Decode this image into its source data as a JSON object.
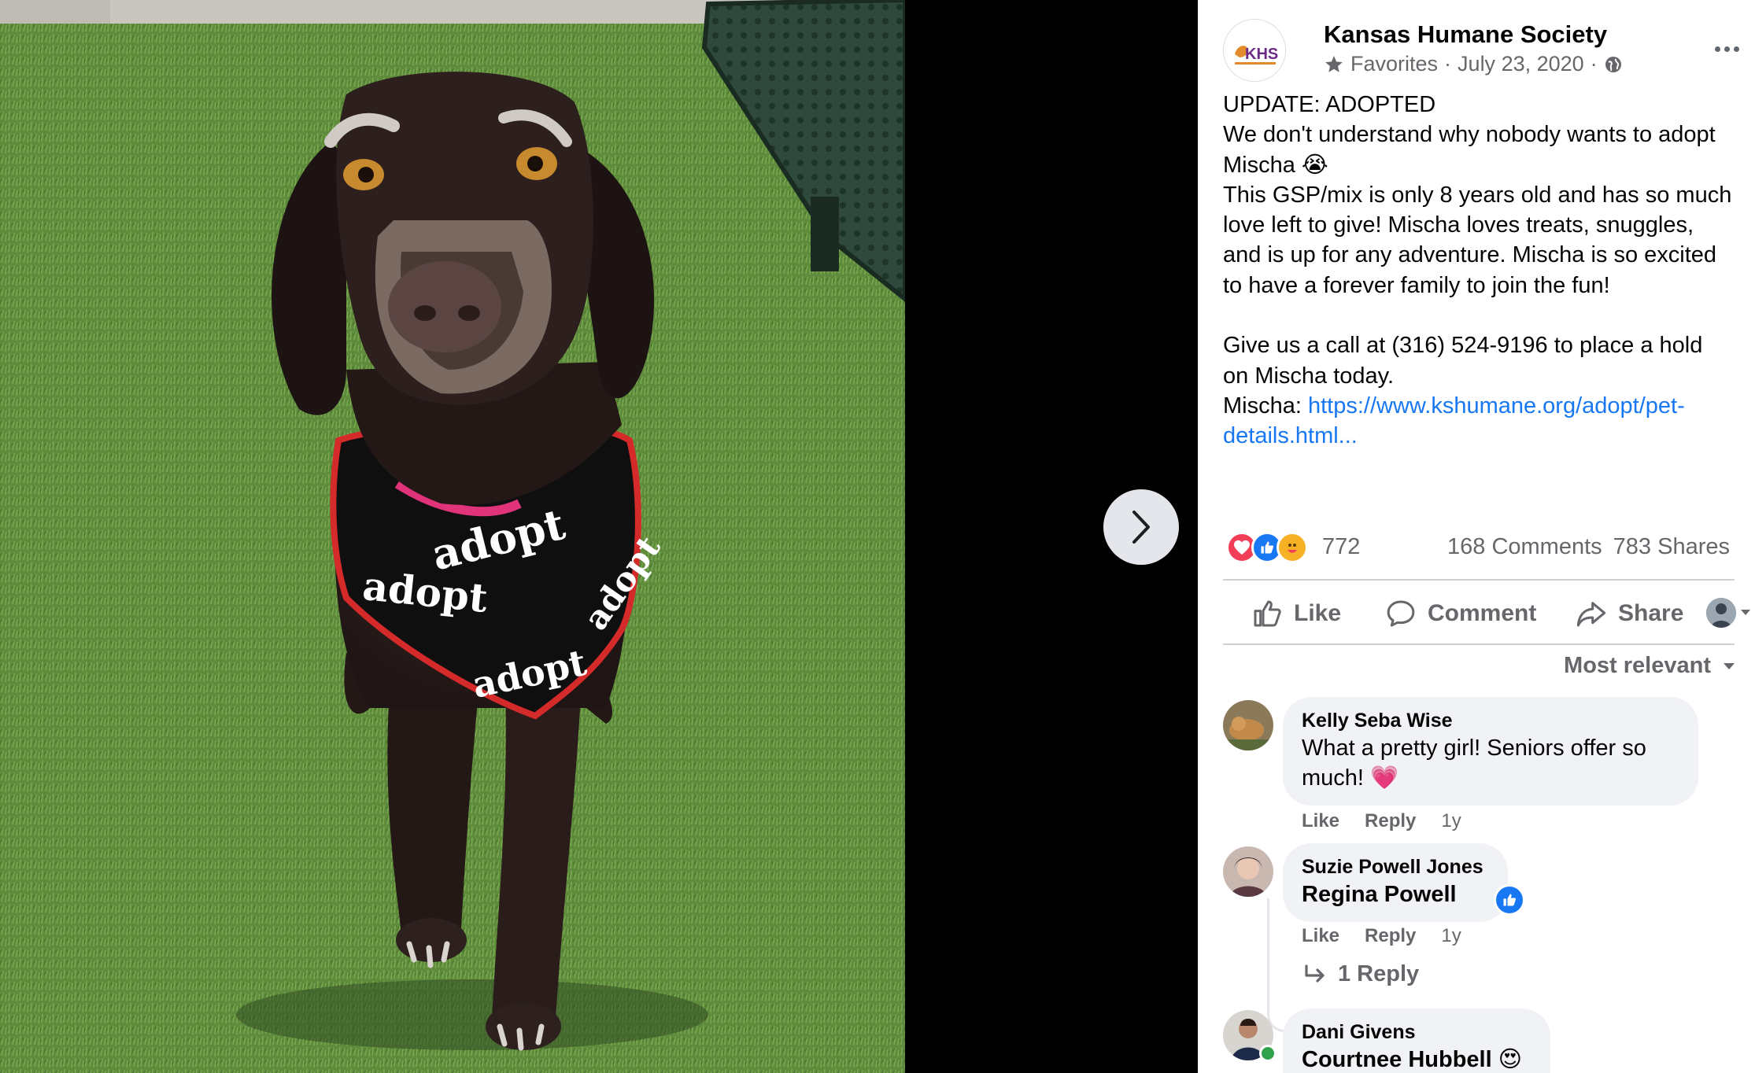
{
  "post": {
    "page_name": "Kansas Humane Society",
    "avatar_text": "KHS",
    "favorites_label": "Favorites",
    "date": "July 23, 2020",
    "separator": "·",
    "text_lines": {
      "l1": "UPDATE: ADOPTED",
      "l2": "We don't understand why nobody wants to adopt Mischa 😭",
      "l3": "This GSP/mix is only 8 years old and has so much love left to give! Mischa loves treats, snuggles, and is up for any adventure. Mischa is so excited to have a forever family to join the fun!",
      "l4": "Give us a call at (316) 524-9196 to place a hold on Mischa today.",
      "l5_prefix": "Mischa: ",
      "l5_link": "https://www.kshumane.org/adopt/pet-details.html..."
    },
    "reaction_count": "772",
    "comments_count": "168 Comments",
    "shares_count": "783 Shares"
  },
  "actions": {
    "like": "Like",
    "comment": "Comment",
    "share": "Share"
  },
  "sort_label": "Most relevant",
  "comments": [
    {
      "name": "Kelly Seba Wise",
      "text": "What a pretty girl! Seniors offer so much! 💗",
      "like": "Like",
      "reply": "Reply",
      "time": "1y"
    },
    {
      "name": "Suzie Powell Jones",
      "text": "Regina Powell",
      "like": "Like",
      "reply": "Reply",
      "time": "1y",
      "replies_label": "1 Reply"
    },
    {
      "name": "Dani Givens",
      "text": "Courtnee Hubbell 😍"
    }
  ],
  "photo": {
    "bandana_word": "adopt"
  },
  "colors": {
    "link": "#1877f2",
    "like_blue": "#1877f2",
    "love_red": "#f33e58",
    "secondary_text": "#65676b",
    "bubble_bg": "#f0f2f5",
    "turf_green": "#5d8a3a"
  }
}
